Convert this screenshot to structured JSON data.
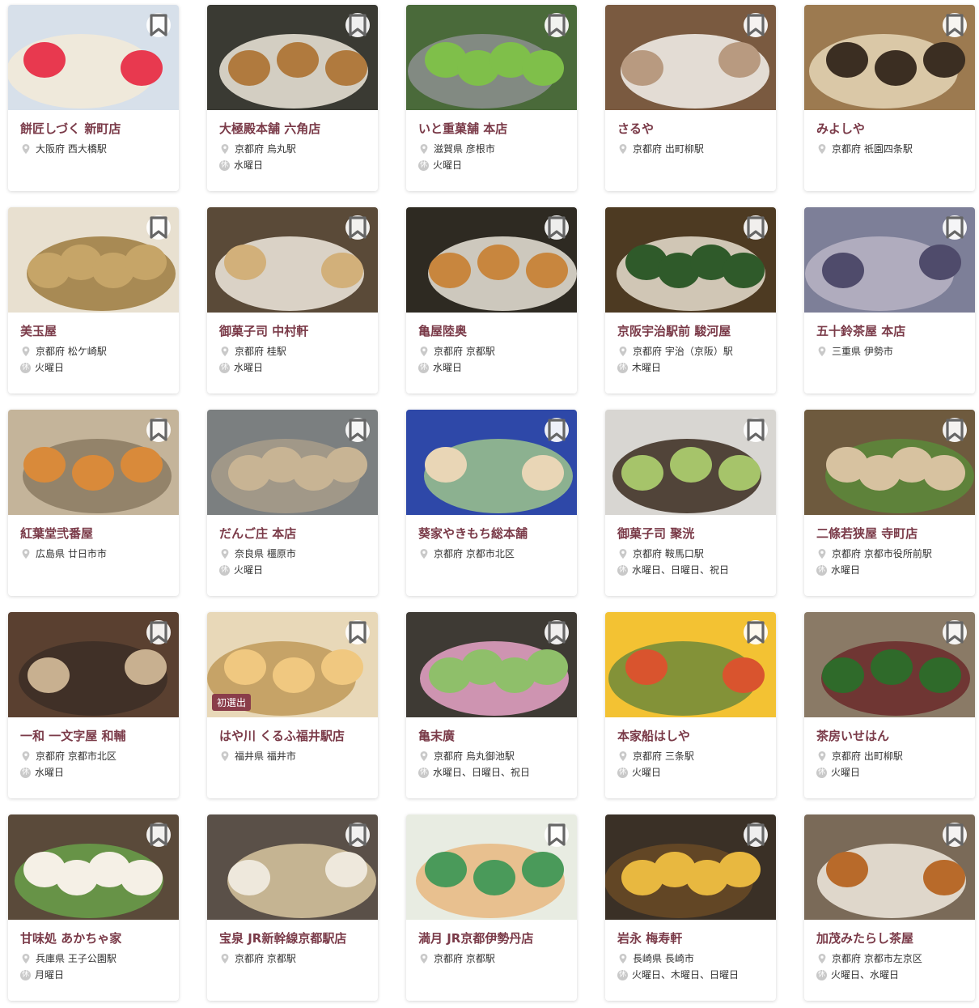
{
  "ui": {
    "closed_mark": "休",
    "accent_color": "#7a3a48"
  },
  "cards": [
    {
      "name": "餅匠しづく 新町店",
      "location": "大阪府 西大橋駅",
      "closed": "",
      "tag": "",
      "palette": [
        "#d7e0ea",
        "#e8394f",
        "#f3ead8"
      ]
    },
    {
      "name": "大極殿本舗 六角店",
      "location": "京都府 烏丸駅",
      "closed": "水曜日",
      "tag": "",
      "palette": [
        "#3a3a33",
        "#b07a3e",
        "#efe9dc"
      ]
    },
    {
      "name": "いと重菓舗 本店",
      "location": "滋賀県 彦根市",
      "closed": "火曜日",
      "tag": "",
      "palette": [
        "#4a6a3a",
        "#7fbf4a",
        "#8c8f8f"
      ]
    },
    {
      "name": "さるや",
      "location": "京都府 出町柳駅",
      "closed": "",
      "tag": "",
      "palette": [
        "#7a5a40",
        "#b89a80",
        "#f6f3ee"
      ]
    },
    {
      "name": "みよしや",
      "location": "京都府 祇園四条駅",
      "closed": "",
      "tag": "",
      "palette": [
        "#9c7a50",
        "#3b2e22",
        "#e5d6b6"
      ]
    },
    {
      "name": "美玉屋",
      "location": "京都府 松ケ崎駅",
      "closed": "火曜日",
      "tag": "",
      "palette": [
        "#e8e0d0",
        "#c6a568",
        "#9c7a3e"
      ]
    },
    {
      "name": "御菓子司 中村軒",
      "location": "京都府 桂駅",
      "closed": "水曜日",
      "tag": "",
      "palette": [
        "#5a4a38",
        "#d2b07a",
        "#f1eadf"
      ]
    },
    {
      "name": "亀屋陸奥",
      "location": "京都府 京都駅",
      "closed": "水曜日",
      "tag": "",
      "palette": [
        "#2e2a22",
        "#c8863e",
        "#e9e4d8"
      ]
    },
    {
      "name": "京阪宇治駅前 駿河屋",
      "location": "京都府 宇治（京阪）駅",
      "closed": "木曜日",
      "tag": "",
      "palette": [
        "#4d3a22",
        "#2f5a2a",
        "#e8dfcf"
      ]
    },
    {
      "name": "五十鈴茶屋 本店",
      "location": "三重県 伊勢市",
      "closed": "",
      "tag": "",
      "palette": [
        "#7d7f98",
        "#4f4b6b",
        "#b8b4c4"
      ]
    },
    {
      "name": "紅葉堂弐番屋",
      "location": "広島県 廿日市市",
      "closed": "",
      "tag": "",
      "palette": [
        "#c4b49a",
        "#d98a3a",
        "#8b7a62"
      ]
    },
    {
      "name": "だんご庄 本店",
      "location": "奈良県 橿原市",
      "closed": "火曜日",
      "tag": "",
      "palette": [
        "#7b7f80",
        "#c8b494",
        "#a89c8a"
      ]
    },
    {
      "name": "葵家やきもち総本舗",
      "location": "京都府 京都市北区",
      "closed": "",
      "tag": "",
      "palette": [
        "#2e48a8",
        "#e9d6b6",
        "#9cc48c"
      ]
    },
    {
      "name": "御菓子司 聚洸",
      "location": "京都府 鞍馬口駅",
      "closed": "水曜日、日曜日、祝日",
      "tag": "",
      "palette": [
        "#d8d6d2",
        "#a6c46a",
        "#3a2a1e"
      ]
    },
    {
      "name": "二條若狭屋 寺町店",
      "location": "京都府 京都市役所前駅",
      "closed": "水曜日",
      "tag": "",
      "palette": [
        "#6e5a3e",
        "#d7c2a0",
        "#5c8a3a"
      ]
    },
    {
      "name": "一和 一文字屋 和輔",
      "location": "京都府 京都市北区",
      "closed": "水曜日",
      "tag": "",
      "palette": [
        "#5a4030",
        "#c8b090",
        "#3c2e26"
      ]
    },
    {
      "name": "はや川 くるふ福井駅店",
      "location": "福井県 福井市",
      "closed": "",
      "tag": "初選出",
      "palette": [
        "#e8d8b8",
        "#f0c880",
        "#c09a58"
      ]
    },
    {
      "name": "亀末廣",
      "location": "京都府 烏丸御池駅",
      "closed": "水曜日、日曜日、祝日",
      "tag": "",
      "palette": [
        "#3e3a34",
        "#8fbf6a",
        "#e8a4c8"
      ]
    },
    {
      "name": "本家船はしや",
      "location": "京都府 三条駅",
      "closed": "火曜日",
      "tag": "",
      "palette": [
        "#f3c233",
        "#d9542e",
        "#6f8a3a"
      ]
    },
    {
      "name": "茶房いせはん",
      "location": "京都府 出町柳駅",
      "closed": "火曜日",
      "tag": "",
      "palette": [
        "#8a7a66",
        "#2f6a2a",
        "#6a2a2a"
      ]
    },
    {
      "name": "甘味処 あかちゃ家",
      "location": "兵庫県 王子公園駅",
      "closed": "月曜日",
      "tag": "",
      "palette": [
        "#5a4a3a",
        "#f5f0e6",
        "#6aa04a"
      ]
    },
    {
      "name": "宝泉 JR新幹線京都駅店",
      "location": "京都府 京都駅",
      "closed": "",
      "tag": "",
      "palette": [
        "#5a5048",
        "#eee8dc",
        "#d8c6a0"
      ]
    },
    {
      "name": "満月 JR京都伊勢丹店",
      "location": "京都府 京都駅",
      "closed": "",
      "tag": "",
      "palette": [
        "#e8ece2",
        "#4a9a5a",
        "#e8b880"
      ]
    },
    {
      "name": "岩永 梅寿軒",
      "location": "長崎県 長崎市",
      "closed": "火曜日、木曜日、日曜日",
      "tag": "",
      "palette": [
        "#3a3026",
        "#e8b840",
        "#6a4a26"
      ]
    },
    {
      "name": "加茂みたらし茶屋",
      "location": "京都府 京都市左京区",
      "closed": "火曜日、水曜日",
      "tag": "",
      "palette": [
        "#7a6a58",
        "#b86a2a",
        "#f1eadf"
      ]
    }
  ]
}
